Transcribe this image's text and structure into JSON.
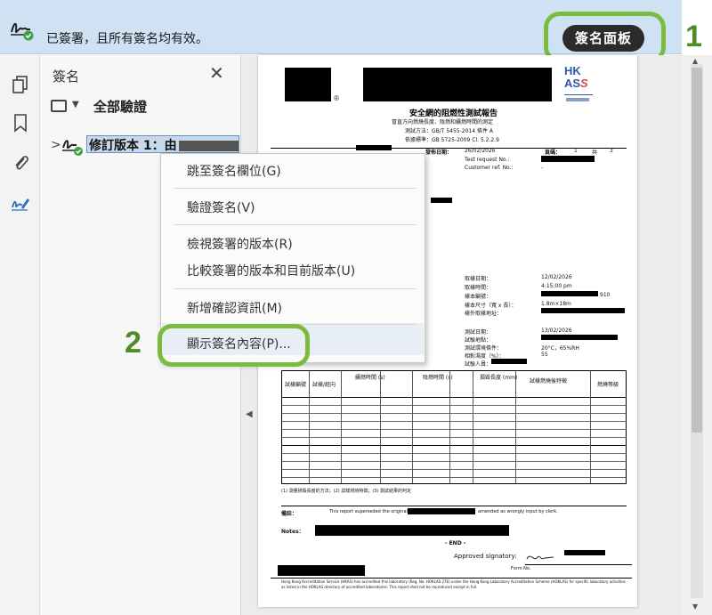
{
  "sigbar": {
    "status": "已簽署，且所有簽名均有效。",
    "panel_button": "簽名面板"
  },
  "annotations": {
    "step1": "1",
    "step2": "2"
  },
  "rail": {
    "icons": [
      "pages-icon",
      "bookmark-icon",
      "attachment-icon",
      "signature-pen-icon"
    ]
  },
  "sigpanel": {
    "title": "簽名",
    "close": "✕",
    "validate_all": "全部驗證",
    "revision_label": "修訂版本 1：由"
  },
  "context_menu": {
    "items": [
      "跳至簽名欄位(G)",
      "驗證簽名(V)",
      "檢視簽署的版本(R)",
      "比較簽署的版本和目前版本(U)",
      "新增確認資訊(M)",
      "顯示簽名內容(P)..."
    ]
  },
  "document": {
    "title": "安全網的阻燃性測試報告",
    "subtitle": "冒直方向燃燒長度、陰燃和續燃時間的測定",
    "method1": "測試方法：GB/T 5455-2014 條件 A",
    "method2": "依據標準：GB 5725-2009 Cl. 5.2.2.9",
    "issue_date_label": "發佈日期：",
    "issue_date": "26/02/2026",
    "page_label": "頁碼：",
    "page_num": "1",
    "page_of": "共",
    "page_total": "3",
    "test_request": "Test request No.:",
    "customer_ref": "Customer ref. No.:",
    "dash": "-",
    "recv_date_label": "取樣日期：",
    "recv_date": "12/02/2026",
    "recv_time_label": "取樣時間：",
    "recv_time": "4:15:00 pm",
    "sample_no_label": "樣本編號：",
    "sample_no_suffix": "910",
    "sample_size_label": "樣本尺寸（寬 x 長）：",
    "sample_size": "1.8m×18m",
    "sample_ext_label": "樣外取樣地址：",
    "test_date_label": "測試日期：",
    "test_date": "13/02/2026",
    "test_loc_label": "試驗地點：",
    "test_env_label": "測試環境條件：",
    "test_env": "20°C，65%RH",
    "humidity_label": "相對濕度（%）：",
    "humidity": "55",
    "tester_label": "試驗人員：",
    "table_headers": [
      "試樣編號",
      "試樣/經向",
      "續燃時間 (s)",
      "陰燃時間 (s)",
      "損毀長度 (mm)",
      "試樣燃燒後特徵",
      "燃燒等級"
    ],
    "footnote": "(1) 測量損毀長度的方法；(2) 試樣燃燒特徵；(3) 測試結果的判定",
    "remarks_label": "備註：",
    "remarks": "This report superseded the original report No.",
    "amended": "amended as wrongly input by clerk.",
    "notes_label": "Notes：",
    "end": "- END -",
    "approved": "Approved signatory:",
    "form_no": "Form No.",
    "footer": "Hong Kong Accreditation Service (HKAS) has accredited this laboratory (Reg. No. HOKLAS 276) under the Hong Kong Laboratory Accreditation Scheme (HOKLAS) for specific laboratory activities as listed in the HOKLAS directory of accredited laboratories. This report shall not be reproduced except in full."
  }
}
